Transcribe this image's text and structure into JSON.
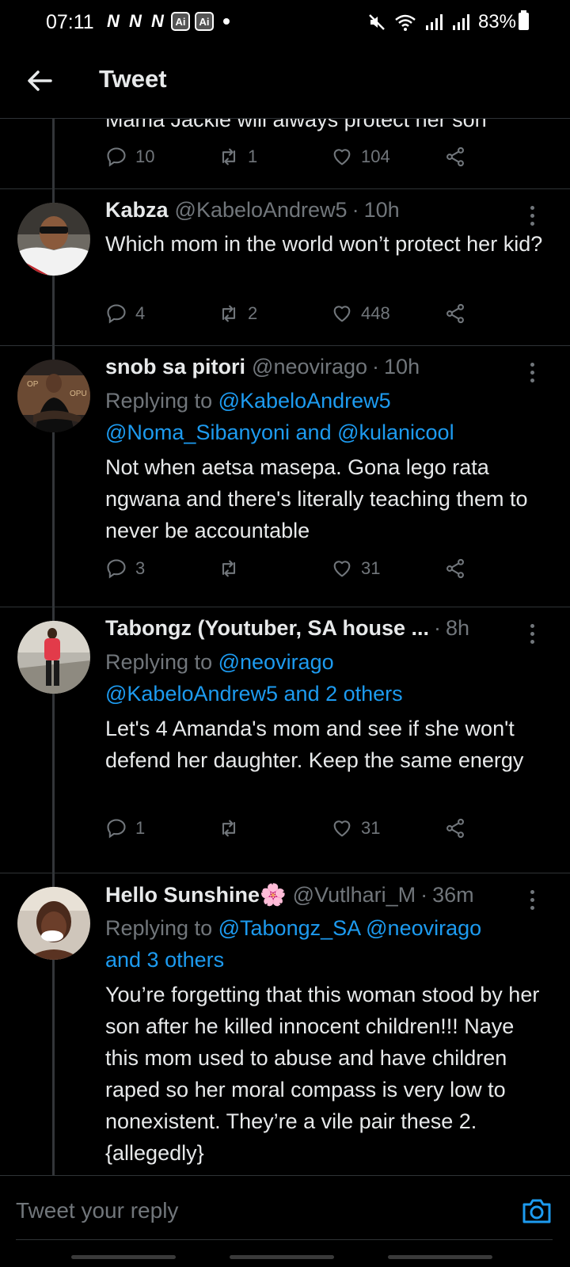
{
  "status_bar": {
    "time": "07:11",
    "notif_letter": "N",
    "ai_label": "Ai",
    "battery": "83%"
  },
  "header": {
    "title": "Tweet"
  },
  "partial_tweet": {
    "text": "Mama Jackie will always protect her son",
    "replies": "10",
    "retweets": "1",
    "likes": "104"
  },
  "tweets": [
    {
      "name": "Kabza",
      "handle": "@KabeloAndrew5",
      "time": "10h",
      "body": "Which mom in the world won’t protect her kid?",
      "replies": "4",
      "retweets": "2",
      "likes": "448"
    },
    {
      "name": "snob sa pitori",
      "handle": "@neovirago",
      "time": "10h",
      "replying_label": "Replying to",
      "mentions_1": "@KabeloAndrew5",
      "mentions_2": "@Noma_Sibanyoni and @kulanicool",
      "body": "Not when aetsa masepa. Gona lego rata ngwana and there's literally teaching them to never be accountable",
      "replies": "3",
      "retweets": "",
      "likes": "31"
    },
    {
      "name": "Tabongz (Youtuber, SA house ...",
      "handle": "",
      "time": "8h",
      "replying_label": "Replying to",
      "mentions_1": "@neovirago",
      "mentions_2": "@KabeloAndrew5 and 2 others",
      "body": "Let's 4 Amanda's mom and see if she won't defend her daughter. Keep the same energy",
      "replies": "1",
      "retweets": "",
      "likes": "31"
    },
    {
      "name": "Hello Sunshine🌸",
      "handle": "@Vutlhari_M",
      "time": "36m",
      "replying_label": "Replying to",
      "mentions_1": "@Tabongz_SA @neovirago",
      "mentions_2": "and 3 others",
      "body": "You’re forgetting that this woman stood by her son after he killed innocent children!!! Naye this mom used to abuse and have children raped so her moral compass is very low to nonexistent. They’re a vile pair these 2. {allegedly}"
    }
  ],
  "reply_bar": {
    "placeholder": "Tweet your reply"
  },
  "colors": {
    "accent": "#1d9bf0",
    "muted": "#71767b",
    "text": "#e7e9ea",
    "background": "#000000"
  }
}
